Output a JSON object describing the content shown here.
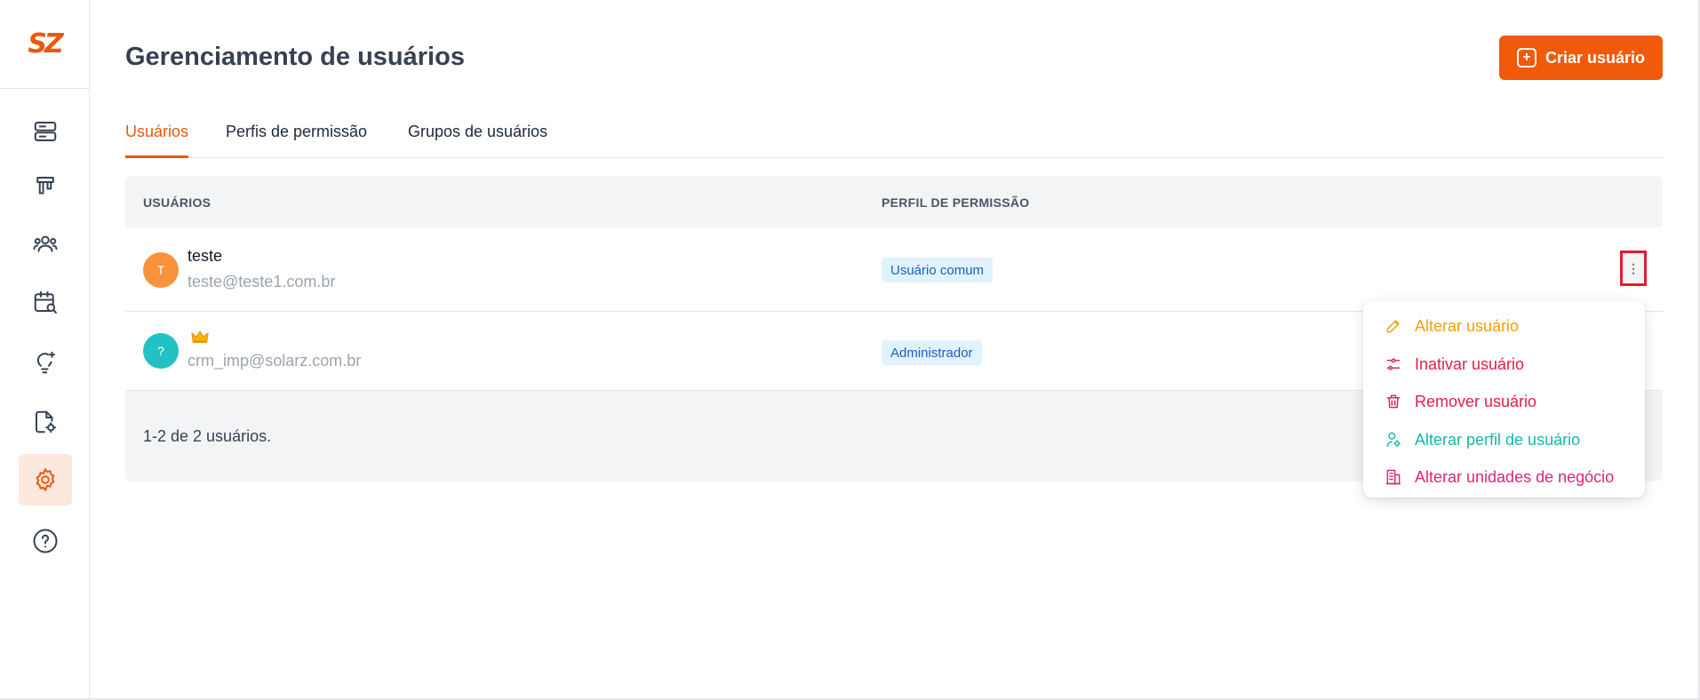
{
  "brand": {
    "logo_text": "SZ"
  },
  "sidebar": {
    "items": [
      {
        "id": "servers",
        "icon": "server-icon"
      },
      {
        "id": "kanban",
        "icon": "kanban-icon"
      },
      {
        "id": "contacts",
        "icon": "users-group-icon"
      },
      {
        "id": "calendar",
        "icon": "calendar-search-icon"
      },
      {
        "id": "ideas",
        "icon": "lightbulb-icon"
      },
      {
        "id": "documents",
        "icon": "file-settings-icon"
      },
      {
        "id": "settings",
        "icon": "gear-icon",
        "active": true
      },
      {
        "id": "help",
        "icon": "help-circle-icon"
      }
    ]
  },
  "header": {
    "title": "Gerenciamento de usuários",
    "create_button_label": "Criar usuário"
  },
  "tabs": [
    {
      "label": "Usuários",
      "active": true
    },
    {
      "label": "Perfis de permissão",
      "active": false
    },
    {
      "label": "Grupos de usuários",
      "active": false
    }
  ],
  "table": {
    "columns": [
      "USUÁRIOS",
      "PERFIL DE PERMISSÃO"
    ],
    "rows": [
      {
        "avatar": "T",
        "avatar_color": "#fb923c",
        "name": "teste",
        "email": "teste@teste1.com.br",
        "profile": "Usuário comum"
      },
      {
        "avatar": "?",
        "avatar_color": "#22c1c3",
        "name": "",
        "email": "crm_imp@solarz.com.br",
        "profile": "Administrador",
        "crown": true
      }
    ],
    "more_label": "⋮",
    "footer": "1-2 de 2 usuários."
  },
  "menu": {
    "items": [
      {
        "label": "Alterar usuário",
        "icon": "pencil-icon",
        "color": "#f59e0b"
      },
      {
        "label": "Inativar usuário",
        "icon": "sliders-icon",
        "color": "#e11d48"
      },
      {
        "label": "Remover usuário",
        "icon": "trash-icon",
        "color": "#e11d48"
      },
      {
        "label": "Alterar perfil de usuário",
        "icon": "user-settings-icon",
        "color": "#14b8a6"
      },
      {
        "label": "Alterar unidades de negócio",
        "icon": "building-icon",
        "color": "#db2777"
      }
    ]
  },
  "colors": {
    "accent": "#f05a0a",
    "badge_bg": "#e0f2fe",
    "badge_text": "#1e5fbf"
  }
}
